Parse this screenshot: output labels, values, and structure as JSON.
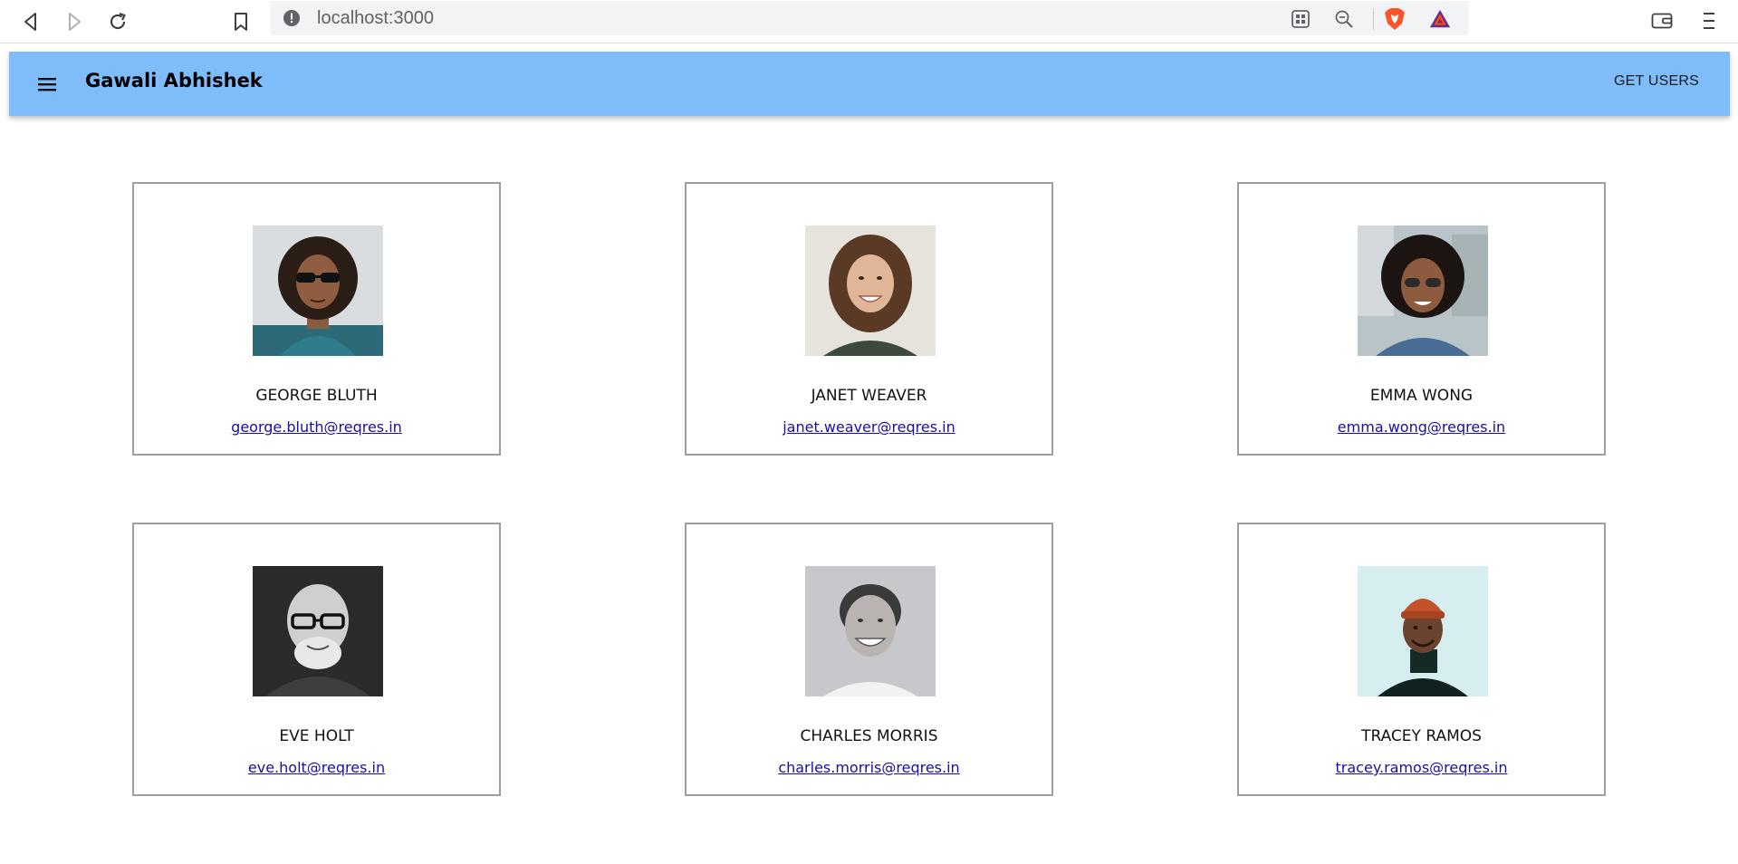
{
  "browser": {
    "url": "localhost:3000",
    "icons": [
      "back-icon",
      "forward-icon",
      "reload-icon",
      "bookmark-icon",
      "info-icon",
      "qr-code-icon",
      "zoom-out-icon",
      "brave-shield-icon",
      "bat-rewards-icon",
      "wallet-icon",
      "menu-icon"
    ]
  },
  "app_bar": {
    "title": "Gawali Abhishek",
    "action_label": "GET USERS",
    "color": "#7fbcfa"
  },
  "users": [
    {
      "name": "GEORGE BLUTH",
      "email": "george.bluth@reqres.in"
    },
    {
      "name": "JANET WEAVER",
      "email": "janet.weaver@reqres.in"
    },
    {
      "name": "EMMA WONG",
      "email": "emma.wong@reqres.in"
    },
    {
      "name": "EVE HOLT",
      "email": "eve.holt@reqres.in"
    },
    {
      "name": "CHARLES MORRIS",
      "email": "charles.morris@reqres.in"
    },
    {
      "name": "TRACEY RAMOS",
      "email": "tracey.ramos@reqres.in"
    }
  ]
}
